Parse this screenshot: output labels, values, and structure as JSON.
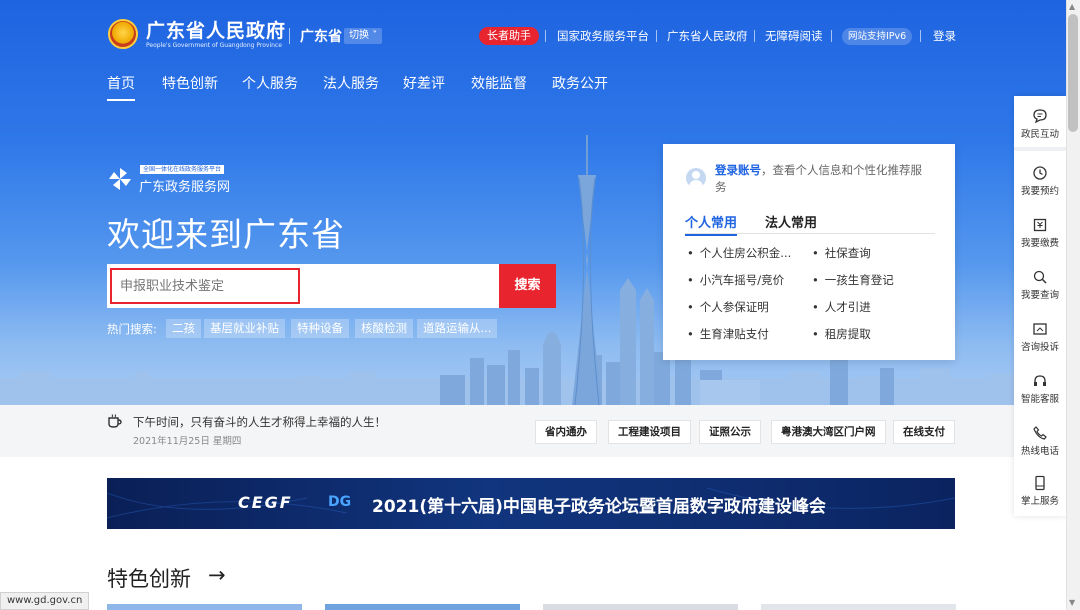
{
  "header": {
    "site_title": "广东省人民政府",
    "site_subtitle": "People's Government of Guangdong Province",
    "region": "广东省",
    "switch_label": "切换",
    "elder_assistant": "长者助手",
    "links": [
      "国家政务服务平台",
      "广东省人民政府",
      "无障碍阅读"
    ],
    "ipv6_badge": "网站支持IPv6",
    "login": "登录"
  },
  "nav": {
    "items": [
      "首页",
      "特色创新",
      "个人服务",
      "法人服务",
      "好差评",
      "效能监督",
      "政务公开"
    ],
    "active": "首页"
  },
  "hero": {
    "brand_small": "全国一体化在线政务服务平台",
    "brand_name": "广东政务服务网",
    "welcome": "欢迎来到广东省",
    "search_placeholder": "申报职业技术鉴定",
    "search_button": "搜索",
    "hot_label": "热门搜索:",
    "hot_tags": [
      "二孩",
      "基层就业补贴",
      "特种设备",
      "核酸检测",
      "道路运输从..."
    ]
  },
  "card": {
    "login_link": "登录账号",
    "login_desc": "，查看个人信息和个性化推荐服务",
    "tabs": [
      "个人常用",
      "法人常用"
    ],
    "active_tab": "个人常用",
    "items": [
      "个人住房公积金...",
      "社保查询",
      "小汽车摇号/竞价",
      "一孩生育登记",
      "个人参保证明",
      "人才引进",
      "生育津贴支付",
      "租房提取"
    ]
  },
  "strip": {
    "quote": "下午时间，只有奋斗的人生才称得上幸福的人生！",
    "date": "2021年11月25日 星期四",
    "buttons": [
      "省内通办",
      "工程建设项目",
      "证照公示",
      "粤港澳大湾区门户网",
      "在线支付"
    ]
  },
  "banner": {
    "cegf": "CEGF",
    "logo": "DG",
    "text": "2021(第十六届)中国电子政务论坛暨首届数字政府建设峰会"
  },
  "section": {
    "title": "特色创新",
    "arrow": "→"
  },
  "sidebar": {
    "items": [
      "政民互动",
      "我要预约",
      "我要缴费",
      "我要查询",
      "咨询投诉",
      "智能客服",
      "热线电话",
      "掌上服务"
    ]
  },
  "status_url": "www.gd.gov.cn",
  "colors": {
    "brand_blue": "#1e63e0",
    "accent_red": "#e8242e"
  }
}
